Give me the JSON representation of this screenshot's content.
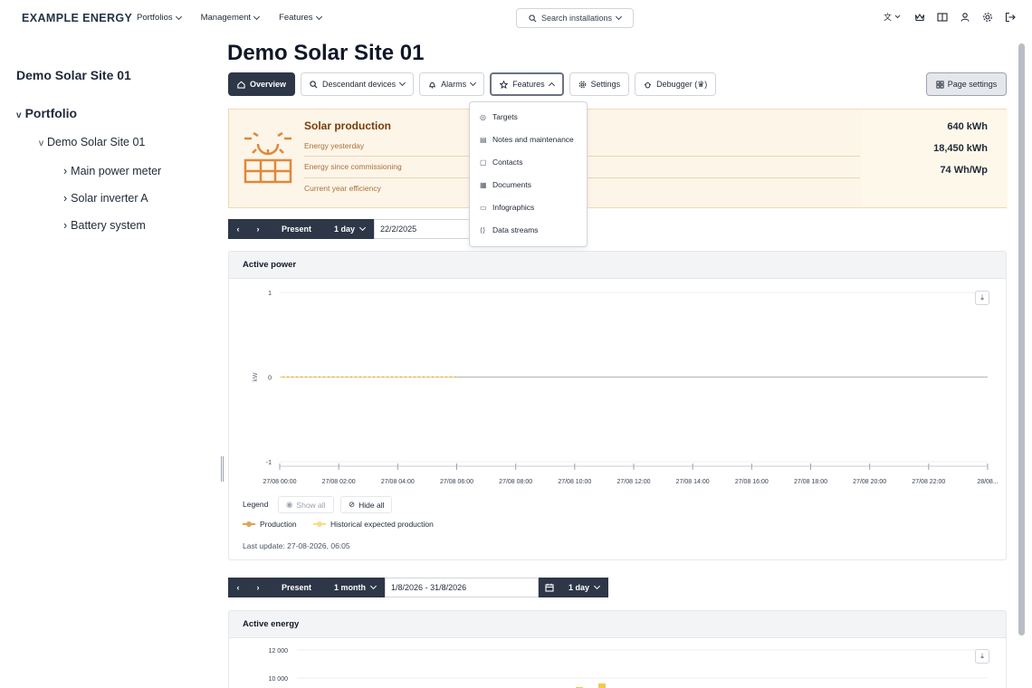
{
  "brand": "EXAMPLE ENERGY",
  "topnav": [
    {
      "label": "Portfolios"
    },
    {
      "label": "Management"
    },
    {
      "label": "Features"
    }
  ],
  "search": {
    "placeholder": "Search installations"
  },
  "tree": {
    "title": "Demo Solar Site 01",
    "portfolio": "Portfolio",
    "site": "Demo Solar Site 01",
    "children": [
      "Main power meter",
      "Solar inverter A",
      "Battery system"
    ]
  },
  "page": {
    "title": "Demo Solar Site 01"
  },
  "toolbar": {
    "overview": "Overview",
    "descendant": "Descendant devices",
    "alarms": "Alarms",
    "features": "Features",
    "settings": "Settings",
    "debugger": "Debugger (♛)",
    "page_settings": "Page settings"
  },
  "features_menu": [
    "Targets",
    "Notes and maintenance",
    "Contacts",
    "Documents",
    "Infographics",
    "Data streams"
  ],
  "solar": {
    "title": "Solar production",
    "rows": [
      {
        "label": "Energy yesterday",
        "value": "640 kWh"
      },
      {
        "label": "Energy since commissioning",
        "value": "18,450 kWh"
      },
      {
        "label": "Current year efficiency",
        "value": "74 Wh/Wp"
      }
    ],
    "accent": "#e0883a"
  },
  "datenav1": {
    "present": "Present",
    "period": "1 day",
    "date": "22/2/2025"
  },
  "datenav2": {
    "present": "Present",
    "period": "1 month",
    "date": "1/8/2026 - 31/8/2026",
    "resolution": "1 day"
  },
  "active_power": {
    "title": "Active power",
    "legend_label": "Legend",
    "show_all": "Show all",
    "hide_all": "Hide all",
    "series": [
      {
        "name": "Production",
        "color": "#e0a25a"
      },
      {
        "name": "Historical expected production",
        "color": "#f3dd8f"
      }
    ],
    "last_update": "Last update: 27-08-2026, 06:05"
  },
  "active_energy": {
    "title": "Active energy"
  },
  "chart_data": [
    {
      "type": "line",
      "title": "Active power",
      "ylabel": "kW",
      "ylim": [
        -1,
        1
      ],
      "yticks": [
        "1",
        "0",
        "-1"
      ],
      "x": [
        "27/08 00:00",
        "27/08 02:00",
        "27/08 04:00",
        "27/08 06:00",
        "27/08 08:00",
        "27/08 10:00",
        "27/08 12:00",
        "27/08 14:00",
        "27/08 16:00",
        "27/08 18:00",
        "27/08 20:00",
        "27/08 22:00",
        "28/08..."
      ],
      "series": [
        {
          "name": "Production",
          "values": [
            0,
            0,
            0,
            0
          ]
        },
        {
          "name": "Historical expected production",
          "values": [
            0,
            0,
            0,
            0
          ]
        }
      ],
      "grid": true
    },
    {
      "type": "bar",
      "title": "Active energy",
      "yticks": [
        "12 000",
        "10 000"
      ],
      "grid": true
    }
  ]
}
